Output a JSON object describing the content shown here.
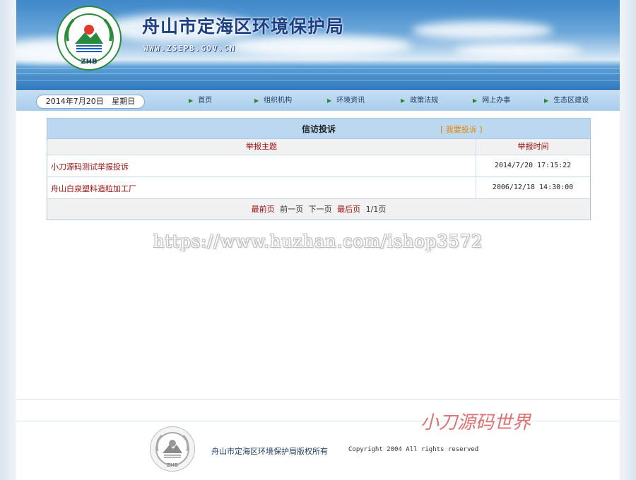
{
  "header": {
    "title": "舟山市定海区环境保护局",
    "url": "WWW.ZSEPB.GOV.CN",
    "logo_text": "ZHB"
  },
  "date_bar": {
    "date": "2014年7月20日",
    "weekday": "星期日"
  },
  "nav": {
    "items": [
      {
        "label": "首页"
      },
      {
        "label": "组织机构"
      },
      {
        "label": "环境资讯"
      },
      {
        "label": "政策法规"
      },
      {
        "label": "网上办事"
      },
      {
        "label": "生态区建设"
      }
    ]
  },
  "petition": {
    "title": "信访投诉",
    "action_label": "[ 我要投诉 ]",
    "columns": {
      "subject": "举报主题",
      "time": "举报时间"
    },
    "rows": [
      {
        "subject": "小刀源码测试举报投诉",
        "time": "2014/7/20 17:15:22"
      },
      {
        "subject": "舟山白泉塑料造粒加工厂",
        "time": "2006/12/18 14:30:00"
      }
    ],
    "pager": {
      "first": "最前页",
      "prev": "前一页",
      "next": "下一页",
      "last": "最后页",
      "page_info": "1/1页"
    }
  },
  "watermark": "https://www.huzhan.com/ishop3572",
  "signature": "小刀源码世界",
  "footer": {
    "owner": "舟山市定海区环境保护局版权所有",
    "copyright": "Copyright 2004 All rights reserved"
  },
  "colors": {
    "nav_bg": "#bcd7f0",
    "title_blue": "#1d3f85",
    "link_red": "#a01010",
    "action_orange": "#e58a00",
    "logo_green": "#2a8a3c"
  }
}
